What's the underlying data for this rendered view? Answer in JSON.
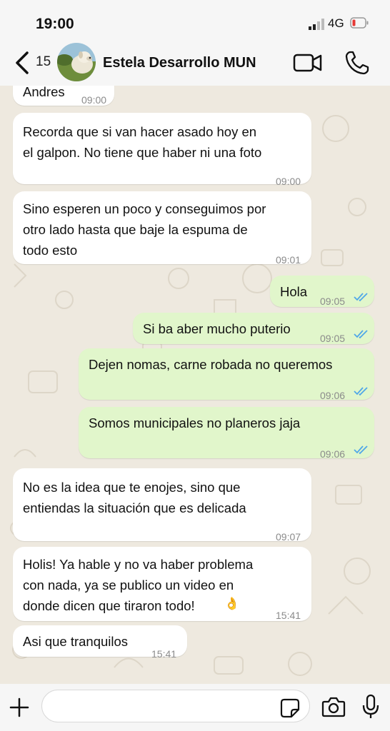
{
  "status_bar": {
    "time": "19:00",
    "network": "4G"
  },
  "header": {
    "unread_count": "15",
    "contact_name": "Estela Desarrollo MUN"
  },
  "messages": [
    {
      "sender": "Andres",
      "time": "09:00",
      "direction": "in"
    },
    {
      "text": "Recorda que si van hacer asado hoy en\nel galpon. No tiene que haber ni una foto",
      "time": "09:00",
      "direction": "in"
    },
    {
      "text": "Sino esperen un poco y conseguimos por\notro lado hasta que baje la espuma de\ntodo esto",
      "time": "09:01",
      "direction": "in"
    },
    {
      "text": "Hola",
      "time": "09:05",
      "direction": "out",
      "read": true
    },
    {
      "text": "Si ba aber mucho puterio",
      "time": "09:05",
      "direction": "out",
      "read": true
    },
    {
      "text": "Dejen nomas, carne robada no queremos",
      "time": "09:06",
      "direction": "out",
      "read": true
    },
    {
      "text": "Somos municipales no planeros jaja",
      "time": "09:06",
      "direction": "out",
      "read": true
    },
    {
      "text": "No es la idea que te enojes, sino que\nentiendas la situación que es delicada",
      "time": "09:07",
      "direction": "in"
    },
    {
      "text": "Holis! Ya hable y no va haber problema\ncon nada, ya se publico un video en\ndonde dicen que tiraron todo!",
      "emoji": "👌",
      "time": "15:41",
      "direction": "in"
    },
    {
      "text": "Asi que tranquilos",
      "time": "15:41",
      "direction": "in"
    }
  ],
  "colors": {
    "incoming_bubble": "#ffffff",
    "outgoing_bubble": "#e1f6cb",
    "read_ticks": "#4fa7e8",
    "wallpaper": "#eee9df"
  },
  "icons": {
    "back": "chevron-left-icon",
    "video": "video-camera-icon",
    "call": "phone-icon",
    "attach": "plus-icon",
    "sticker": "sticker-icon",
    "camera": "camera-icon",
    "mic": "microphone-icon"
  },
  "composer": {
    "value": ""
  }
}
